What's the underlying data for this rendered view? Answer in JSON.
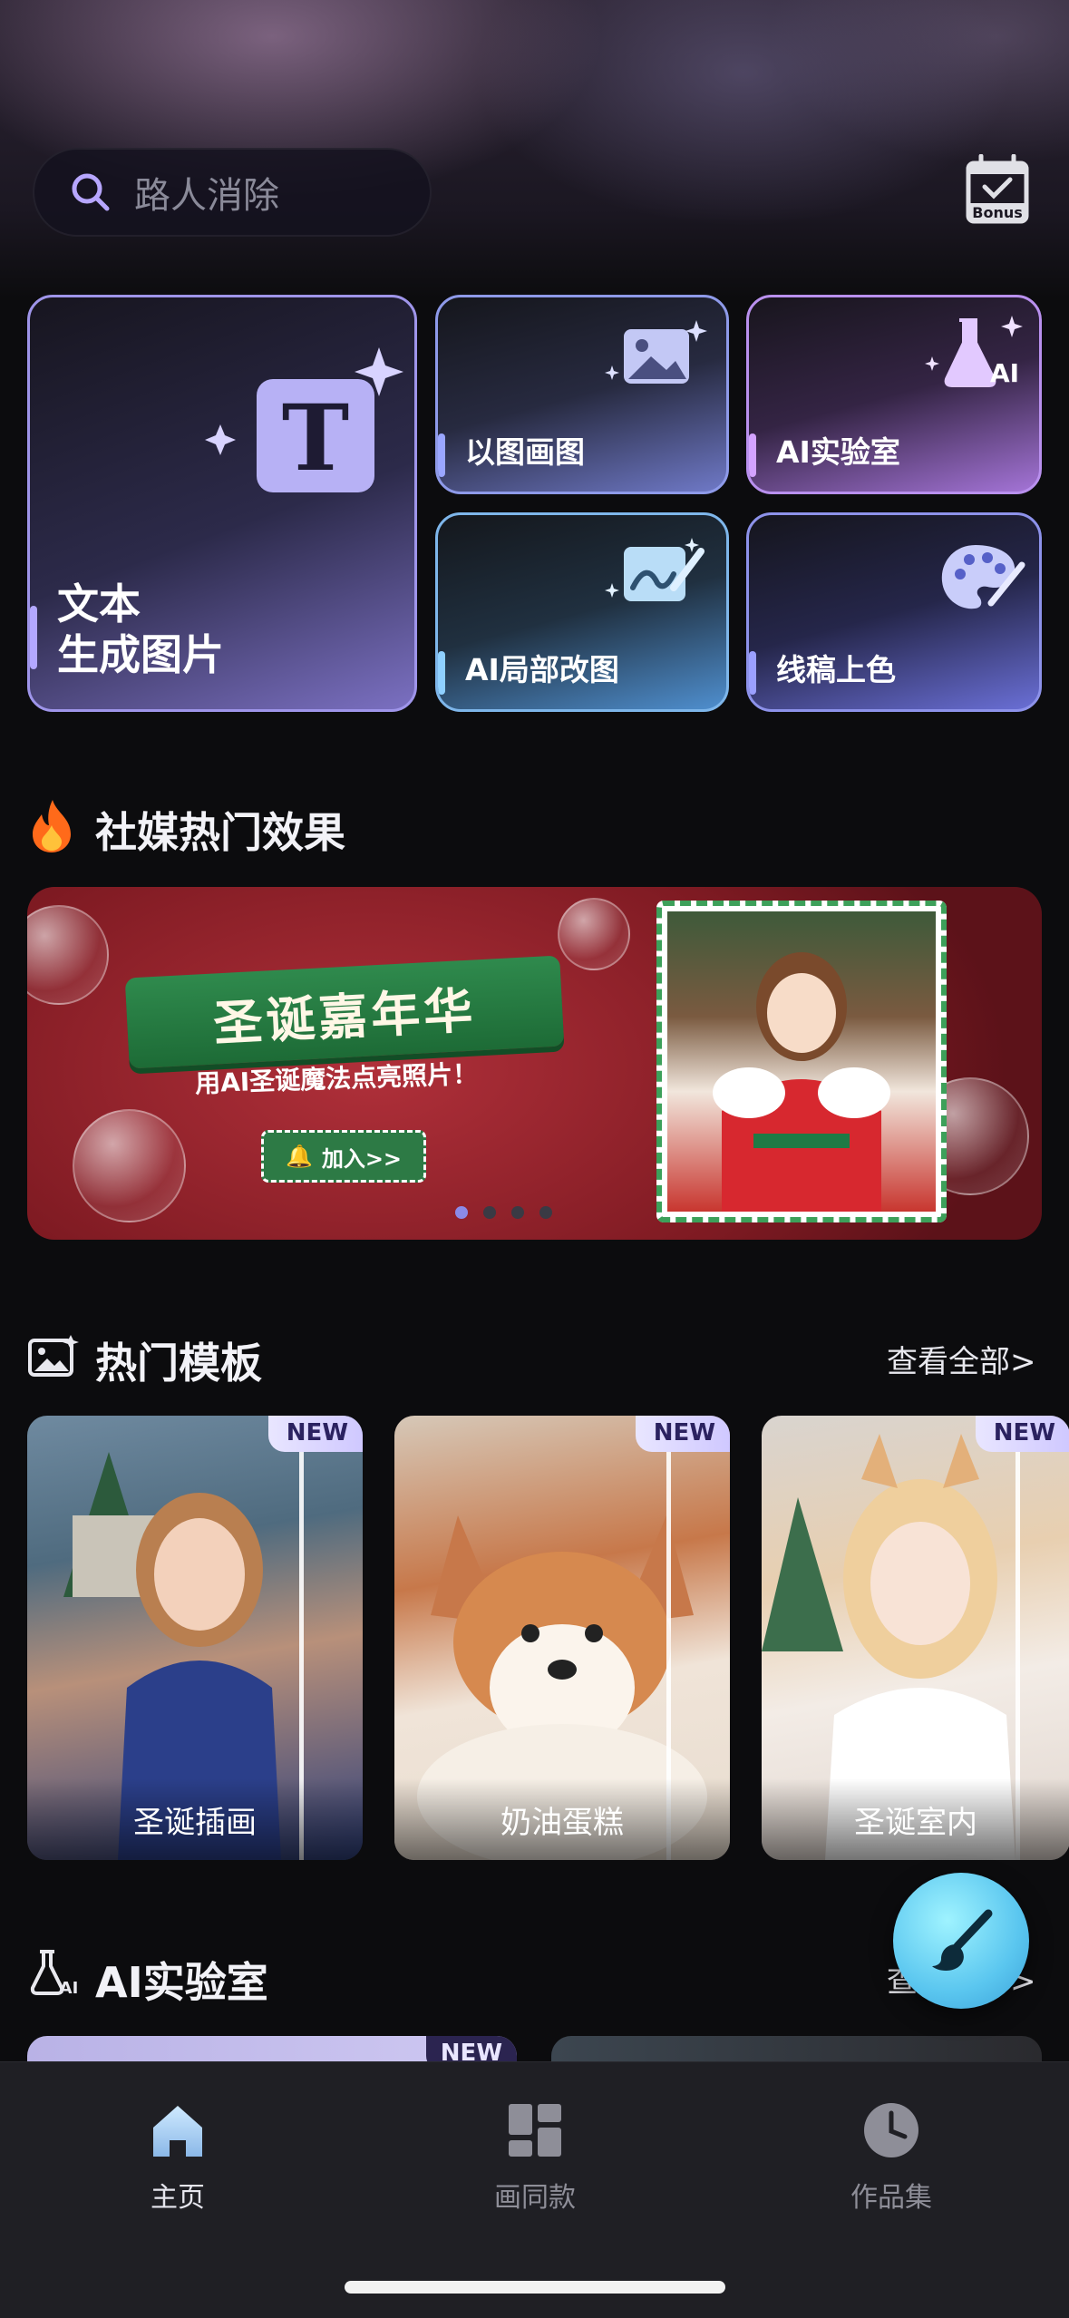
{
  "header": {
    "search_placeholder": "路人消除",
    "bonus_label": "Bonus"
  },
  "features": {
    "text_to_image": "文本\n生成图片",
    "image_to_image": "以图画图",
    "ai_lab": "AI实验室",
    "ai_partial_edit": "AI局部改图",
    "line_art_color": "线稿上色"
  },
  "social_section": {
    "title": "社媒热门效果",
    "banner": {
      "title": "圣诞嘉年华",
      "subtitle": "用AI圣诞魔法点亮照片！",
      "button": "加入>>"
    },
    "pager_total": 4,
    "pager_active": 0
  },
  "templates_section": {
    "title": "热门模板",
    "see_all": "查看全部>",
    "cards": [
      {
        "label": "圣诞插画",
        "badge": "NEW"
      },
      {
        "label": "奶油蛋糕",
        "badge": "NEW"
      },
      {
        "label": "圣诞室内",
        "badge": "NEW"
      }
    ]
  },
  "lab_section": {
    "title": "AI实验室",
    "see_all": "查看全部>",
    "card_badge": "NEW"
  },
  "bottom_nav": {
    "items": [
      {
        "label": "主页",
        "icon": "home-icon",
        "active": true
      },
      {
        "label": "画同款",
        "icon": "grid-icon",
        "active": false
      },
      {
        "label": "作品集",
        "icon": "clock-icon",
        "active": false
      }
    ]
  },
  "colors": {
    "accent": "#9f95ea",
    "background": "#0c0c0e",
    "nav_background": "#1f1f24",
    "banner_red": "#8e1f28",
    "banner_green": "#2f8a4d"
  }
}
